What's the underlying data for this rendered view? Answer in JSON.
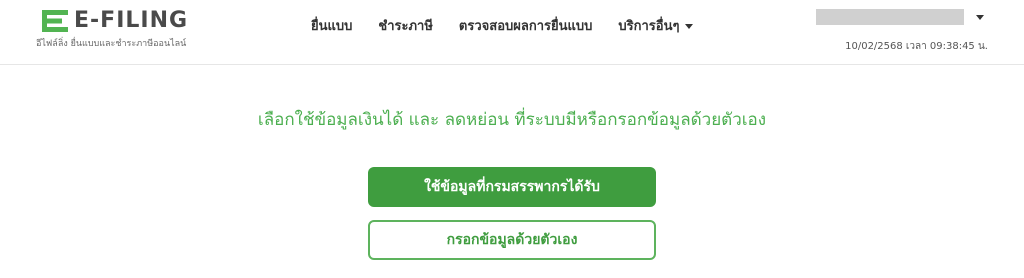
{
  "brand": {
    "logo_text": "E-FILING",
    "tagline": "อีไฟล์ลิ่ง ยื่นแบบและชำระภาษีออนไลน์",
    "accent_color": "#4caf50",
    "logo_mark_color": "#52b452"
  },
  "nav": {
    "items": [
      {
        "label": "ยื่นแบบ"
      },
      {
        "label": "ชำระภาษี"
      },
      {
        "label": "ตรวจสอบผลการยื่นแบบ"
      },
      {
        "label": "บริการอื่นๆ"
      }
    ]
  },
  "user": {
    "datetime": "10/02/2568 เวลา 09:38:45 น."
  },
  "main": {
    "headline": "เลือกใช้ข้อมูลเงินได้ และ ลดหย่อน ที่ระบบมีหรือกรอกข้อมูลด้วยตัวเอง",
    "primary_button": "ใช้ข้อมูลที่กรมสรรพากรได้รับ",
    "secondary_button": "กรอกข้อมูลด้วยตัวเอง",
    "primary_color": "#3f9d3f"
  }
}
